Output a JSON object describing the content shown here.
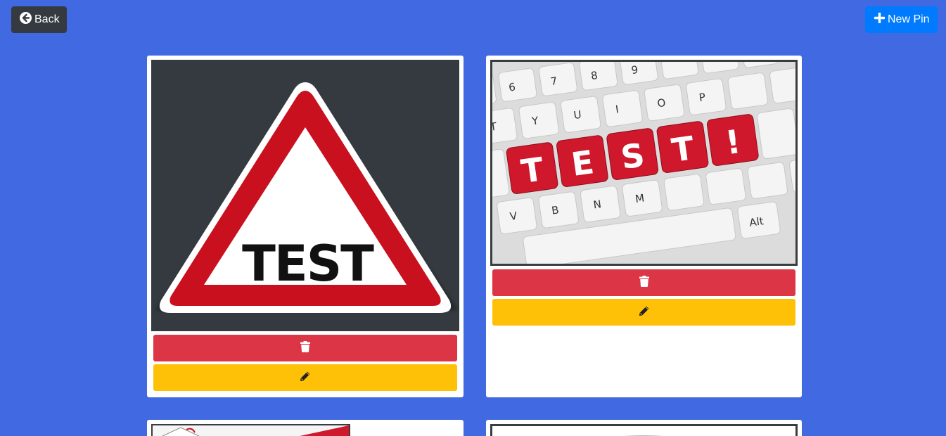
{
  "toolbar": {
    "back_label": "Back",
    "new_pin_label": "New Pin"
  },
  "pins": [
    {
      "image_text": "TEST",
      "image_icon": "warning-triangle-sign",
      "delete_icon": "trash-icon",
      "edit_icon": "pencil-icon"
    },
    {
      "image_text": [
        "T",
        "E",
        "S",
        "T",
        "!"
      ],
      "image_icon": "keyboard-photo",
      "key_labels": [
        "6",
        "7",
        "8",
        "9",
        "T",
        "Y",
        "U",
        "I",
        "O",
        "P",
        "V",
        "B",
        "N",
        "M",
        "Alt"
      ],
      "delete_icon": "trash-icon",
      "edit_icon": "pencil-icon"
    }
  ],
  "colors": {
    "page_background": "#4169e1",
    "back_button": "#343a40",
    "new_pin_button": "#007bff",
    "delete_button": "#dc3545",
    "edit_button": "#ffc107",
    "sign_red": "#c8101e"
  }
}
